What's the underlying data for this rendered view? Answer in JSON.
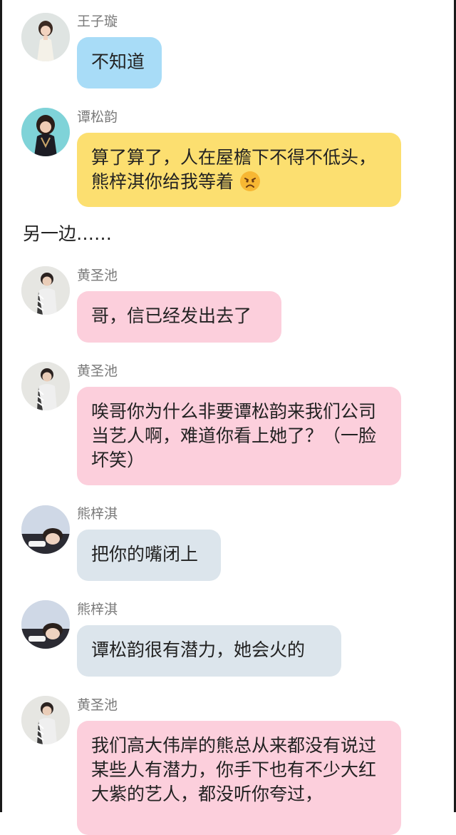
{
  "messages": [
    {
      "sender": "王子璇",
      "text": "不知道",
      "emoji": "",
      "avatar": "girl-avatar-icon",
      "bubble_color": "#a8dcf7"
    },
    {
      "sender": "谭松韵",
      "text": "算了算了，人在屋檐下不得不低头，熊梓淇你给我等着",
      "emoji": "frown-emoji-icon",
      "avatar": "woman-avatar-icon",
      "bubble_color": "#fcdf70"
    },
    {
      "sender": "黄圣池",
      "text": "哥，信已经发出去了",
      "emoji": "",
      "avatar": "man-avatar-icon",
      "bubble_color": "#fccfdc"
    },
    {
      "sender": "黄圣池",
      "text": "唉哥你为什么非要谭松韵来我们公司当艺人啊，难道你看上她了？（一脸坏笑）",
      "emoji": "",
      "avatar": "man-avatar-icon",
      "bubble_color": "#fccfdc"
    },
    {
      "sender": "熊梓淇",
      "text": "把你的嘴闭上",
      "emoji": "",
      "avatar": "man-lying-avatar-icon",
      "bubble_color": "#dce5ec"
    },
    {
      "sender": "熊梓淇",
      "text": "谭松韵很有潜力，她会火的",
      "emoji": "",
      "avatar": "man-lying-avatar-icon",
      "bubble_color": "#dce5ec"
    },
    {
      "sender": "黄圣池",
      "text": "我们高大伟岸的熊总从来都没有说过某些人有潜力，你手下也有不少大红大紫的艺人，都没听你夸过，",
      "emoji": "",
      "avatar": "man-avatar-icon",
      "bubble_color": "#fccfdc"
    }
  ],
  "narration": "另一边……"
}
